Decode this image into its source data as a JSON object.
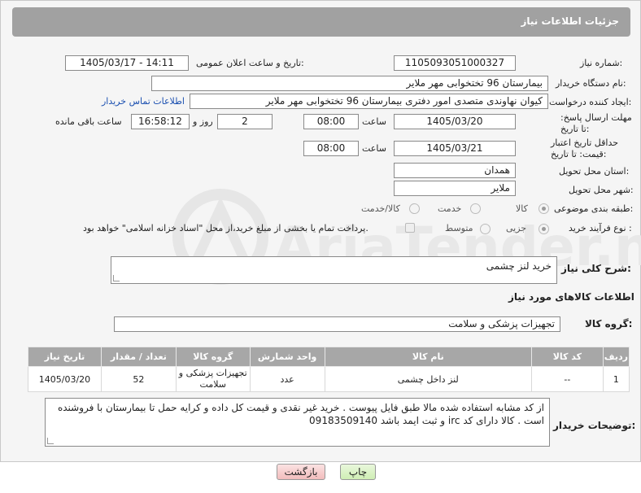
{
  "header": {
    "title": "جزئیات اطلاعات نیاز"
  },
  "fields": {
    "need_number_label": "شماره نیاز:",
    "need_number": "1105093051000327",
    "announce_datetime_label": "تاریخ و ساعت اعلان عمومی:",
    "announce_datetime": "1405/03/17 - 14:11",
    "buyer_org_label": "نام دستگاه خریدار:",
    "buyer_org": "بیمارستان 96 تختخوابی مهر ملایر",
    "requester_label": "ایجاد کننده درخواست:",
    "requester": "کیوان نهاوندی متصدی امور دفتری بیمارستان 96 تختخوابی مهر ملایر",
    "buyer_contact_link": "اطلاعات تماس خریدار",
    "reply_deadline_label": "مهلت ارسال پاسخ: تا تاریخ:",
    "reply_date": "1405/03/20",
    "time_label": "ساعت",
    "reply_time": "08:00",
    "days_value": "2",
    "days_label": "روز و",
    "remaining_time": "16:58:12",
    "remaining_label": "ساعت باقی مانده",
    "price_validity_label": "حداقل تاریخ اعتبار قیمت: تا تاریخ:",
    "validity_date": "1405/03/21",
    "validity_time": "08:00",
    "province_label": "استان محل تحویل:",
    "province": "همدان",
    "city_label": "شهر محل تحویل:",
    "city": "ملایر",
    "category_label": "طبقه بندی موضوعی:",
    "category_options": [
      "کالا",
      "خدمت",
      "کالا/خدمت"
    ],
    "process_label": "نوع فرآیند خرید :",
    "process_options": [
      "جزیی",
      "متوسط"
    ],
    "payment_note": "پرداخت تمام یا بخشی از مبلغ خرید،از محل \"اسناد خزانه اسلامی\" خواهد بود."
  },
  "description": {
    "label": "شرح کلی نیاز:",
    "value": "خرید لنز چشمی"
  },
  "goods_section_title": "اطلاعات کالاهای مورد نیاز",
  "goods_group": {
    "label": "گروه کالا:",
    "value": "تجهیزات پزشکی و سلامت"
  },
  "table": {
    "headers": [
      "ردیف",
      "کد کالا",
      "نام کالا",
      "واحد شمارش",
      "گروه کالا",
      "تعداد / مقدار",
      "تاریخ نیاز"
    ],
    "rows": [
      [
        "1",
        "--",
        "لنز داخل چشمی",
        "عدد",
        "تجهیزات پزشکی و سلامت",
        "52",
        "1405/03/20"
      ]
    ]
  },
  "buyer_notes": {
    "label": "توضیحات خریدار:",
    "value": "از کد مشابه استفاده شده مالا طبق فایل پیوست . خرید غیر نقدی و قیمت کل داده و کرایه حمل تا بیمارستان با فروشنده است . کالا دارای کد irc و ثبت ایمد باشد  09183509140"
  },
  "buttons": {
    "print": "چاپ",
    "back": "بازگشت"
  },
  "watermark": {
    "text": "AriaTender.neT"
  },
  "colors": {
    "header_bg": "#a1a1a1",
    "table_header_bg": "#a7a7a7",
    "link": "#1a4fb0"
  }
}
